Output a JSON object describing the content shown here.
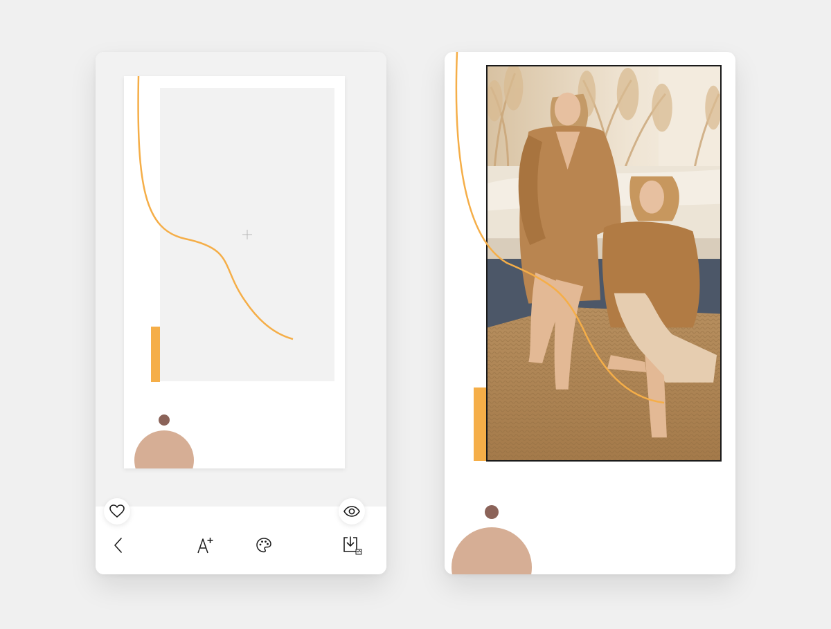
{
  "colors": {
    "background": "#f0f0f0",
    "accent_orange": "#f5ae48",
    "beige_circle": "#d6ae95",
    "brown_dot": "#8b6359",
    "placeholder_gray": "#f2f2f2",
    "icon_dark": "#1a1a1a"
  },
  "editor": {
    "placeholder_icon": "plus-icon",
    "toolbar": {
      "favorite_icon": "heart-icon",
      "preview_icon": "eye-icon",
      "back_icon": "chevron-left-icon",
      "add_text_icon": "add-text-icon",
      "palette_icon": "palette-icon",
      "download_icon": "download-icon"
    }
  },
  "preview": {
    "photo_subject": "two-women-in-camel-robes"
  }
}
